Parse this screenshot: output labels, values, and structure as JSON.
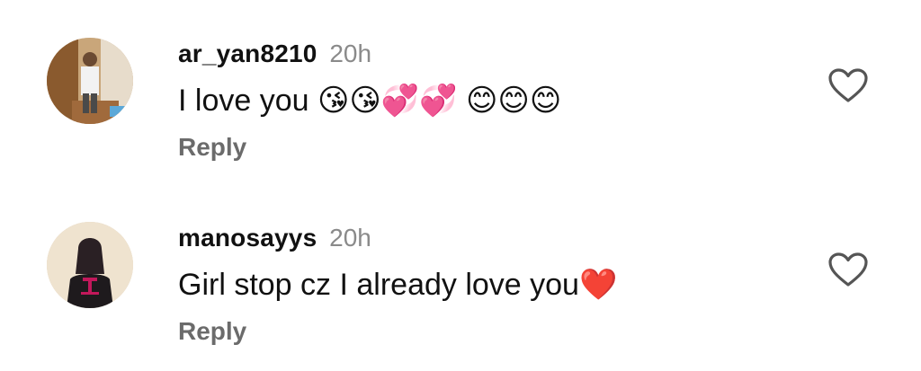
{
  "comments": [
    {
      "username": "ar_yan8210",
      "time": "20h",
      "text": "I love you 😘😘💞💞 😊😊😊",
      "reply_label": "Reply"
    },
    {
      "username": "manosayys",
      "time": "20h",
      "text": "Girl stop cz I already love you❤️",
      "reply_label": "Reply"
    }
  ],
  "icons": {
    "like": "heart-outline-icon"
  },
  "colors": {
    "username": "#111111",
    "muted": "#8a8a8a",
    "reply": "#6b6b6b",
    "icon_stroke": "#555555"
  }
}
